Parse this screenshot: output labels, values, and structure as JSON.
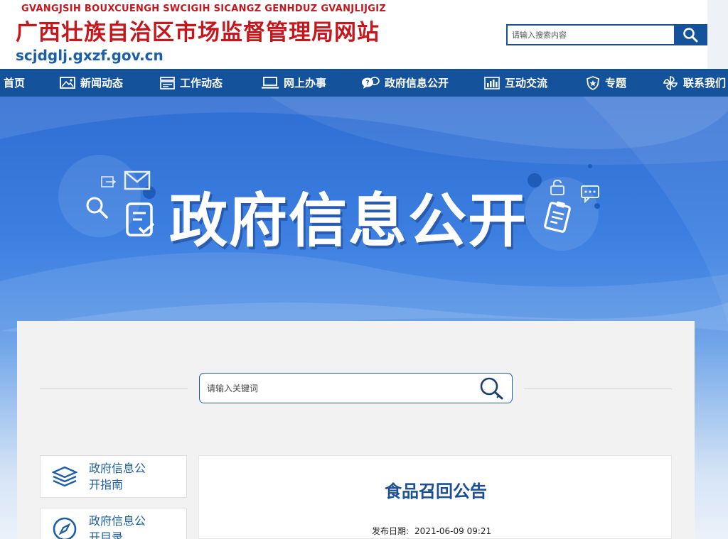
{
  "header": {
    "site_name_roman": "GVANGJSIH BOUXCUENGH SWCIGIH SICANGZ GENHDUZ GVANJLIJGIZ",
    "site_title": "广西壮族自治区市场监督管理局网站",
    "site_domain": "scjdglj.gxzf.gov.cn",
    "search": {
      "placeholder": "请输入搜索内容",
      "button_icon": "search-icon"
    }
  },
  "nav": {
    "items": [
      {
        "label": "首页",
        "icon": ""
      },
      {
        "label": "新闻动态",
        "icon": "image-icon"
      },
      {
        "label": "工作动态",
        "icon": "document-stack-icon"
      },
      {
        "label": "网上办事",
        "icon": "laptop-icon"
      },
      {
        "label": "政府信息公开",
        "icon": "chat-question-icon"
      },
      {
        "label": "互动交流",
        "icon": "bar-chart-icon"
      },
      {
        "label": "专题",
        "icon": "shield-star-icon"
      },
      {
        "label": "联系我们",
        "icon": "pinwheel-icon"
      }
    ]
  },
  "banner": {
    "title": "政府信息公开"
  },
  "keyword_search": {
    "placeholder": "请输入关键词",
    "button_icon": "magnifier-key-icon"
  },
  "sidebar": {
    "items": [
      {
        "label": "政府信息公开指南",
        "icon": "layers-icon"
      },
      {
        "label": "政府信息公开目录",
        "icon": "compass-icon"
      }
    ]
  },
  "article": {
    "title": "食品召回公告",
    "date_label": "发布日期:",
    "date_value": "2021-06-09 09:21"
  },
  "colors": {
    "brand_red": "#c8161d",
    "brand_blue": "#15529c",
    "text_blue": "#1b5faa"
  }
}
